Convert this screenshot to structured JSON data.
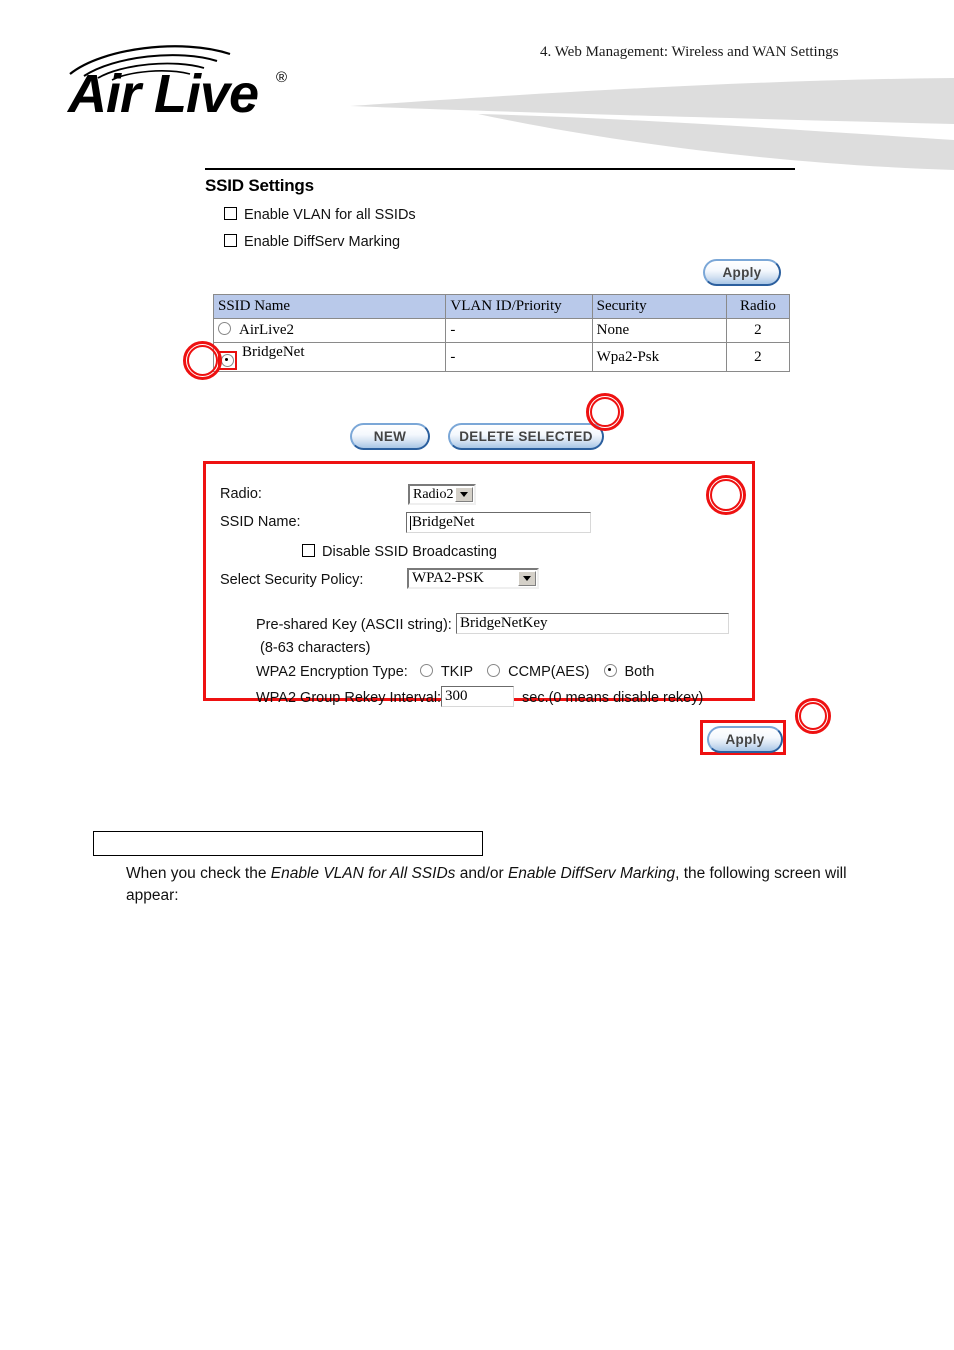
{
  "header": {
    "chapter_title": "4. Web Management: Wireless and WAN Settings",
    "logo_text": "Air Live",
    "logo_registered": "®"
  },
  "screen": {
    "section_title": "SSID Settings",
    "checkboxes": [
      {
        "label": "Enable VLAN for all SSIDs",
        "checked": false
      },
      {
        "label": "Enable DiffServ Marking",
        "checked": false
      }
    ],
    "apply_top_label": "Apply",
    "table": {
      "headers": [
        "SSID  Name",
        "VLAN ID/Priority",
        "Security",
        "Radio"
      ],
      "rows": [
        {
          "name": "AirLive2",
          "vlan": "-",
          "security": "None",
          "radio": "2",
          "selected": false
        },
        {
          "name": "BridgeNet",
          "vlan": "-",
          "security": "Wpa2-Psk",
          "radio": "2",
          "selected": true
        }
      ]
    },
    "new_label": "NEW",
    "delete_label": "DELETE SELECTED",
    "config": {
      "radio_label": "Radio:",
      "radio_value": "Radio2",
      "ssid_name_label": "SSID Name:",
      "ssid_name_value": "BridgeNet",
      "disable_broadcast_label": "Disable SSID Broadcasting",
      "disable_broadcast_checked": false,
      "security_policy_label": "Select Security Policy:",
      "security_policy_value": "WPA2-PSK",
      "psk_label": "Pre-shared Key (ASCII string):",
      "psk_value": "BridgeNetKey",
      "psk_hint": "(8-63 characters)",
      "encryption_label": "WPA2 Encryption Type:",
      "encryption_options": [
        {
          "label": "TKIP",
          "selected": false
        },
        {
          "label": "CCMP(AES)",
          "selected": false
        },
        {
          "label": "Both",
          "selected": true
        }
      ],
      "rekey_label": "WPA2 Group Rekey Interval:",
      "rekey_value": "300",
      "rekey_suffix": "sec.(0 means disable rekey)"
    },
    "apply_bottom_label": "Apply"
  },
  "body_text": {
    "paragraph_part1": "When you check the ",
    "paragraph_em1": "Enable VLAN for All SSIDs",
    "paragraph_part2": " and/or ",
    "paragraph_em2": "Enable DiffServ Marking",
    "paragraph_part3": ", the following screen will appear:"
  },
  "annotation_color": "#ee1111"
}
